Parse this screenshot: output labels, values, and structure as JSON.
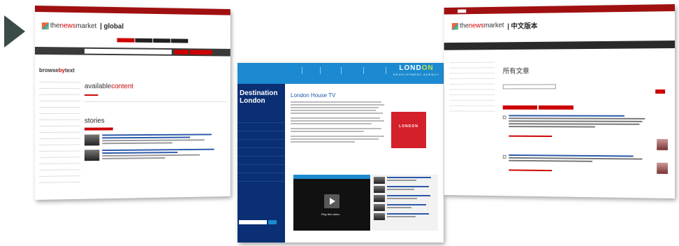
{
  "arrow": {
    "color": "#3c4a4a"
  },
  "shot1": {
    "logo_prefix": "the",
    "logo_highlight": "news",
    "logo_suffix": "market",
    "edition": "| global",
    "tabs": [
      "",
      "",
      "",
      ""
    ],
    "sidebar_title_a": "browse",
    "sidebar_title_b": "by",
    "sidebar_title_c": "text",
    "available_a": "available",
    "available_b": "content",
    "stories_heading": "stories"
  },
  "shot2": {
    "page_title": "London House TV",
    "left_heading": "Destination London",
    "brand_line1_a": "LOND",
    "brand_line1_b": "ON",
    "brand_line2": "DEVELOPMENT AGENCY",
    "badge_line1": "LONDON",
    "video_caption": "Play this video"
  },
  "shot3": {
    "logo_prefix": "the",
    "logo_highlight": "news",
    "logo_suffix": "market",
    "edition": "| 中文版本",
    "heading": "所有文章"
  },
  "colors": {
    "news_red": "#a01010",
    "lda_blue": "#1c8ad0",
    "lda_navy": "#0b2f74",
    "lda_green": "#bfe04a"
  }
}
